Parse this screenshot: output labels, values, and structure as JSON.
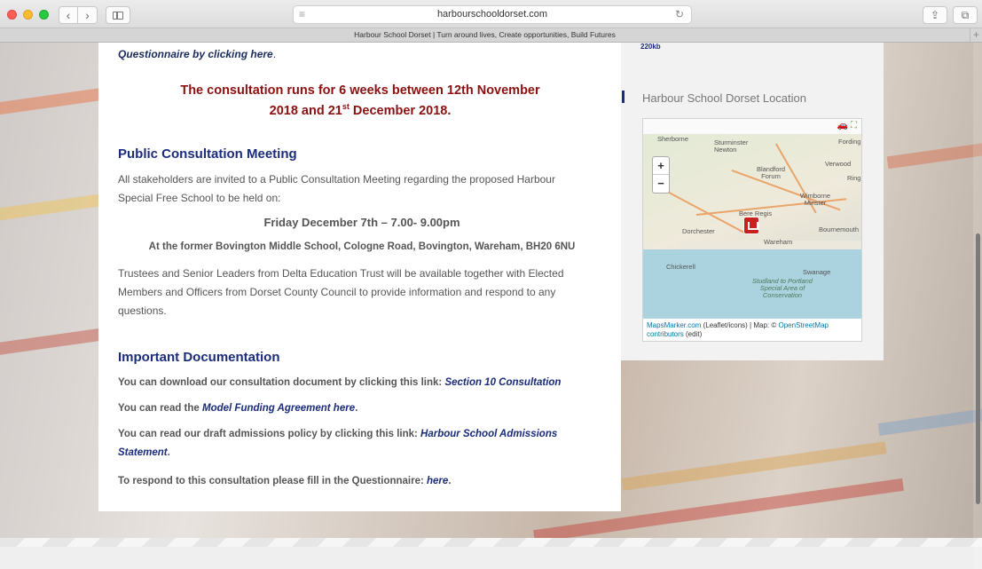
{
  "browser": {
    "url": "harbourschooldorset.com",
    "tab_title": "Harbour School Dorset | Turn around lives, Create opportunities, Build Futures",
    "back_glyph": "‹",
    "forward_glyph": "›",
    "reload_glyph": "↻",
    "reader_glyph": "≡",
    "share_glyph": "⇪",
    "tabs_glyph": "⧉",
    "new_tab_glyph": "+"
  },
  "main": {
    "questionnaire_top": "Questionnaire by clicking here",
    "consultation_banner_1": "The consultation runs for 6 weeks between 12th November",
    "consultation_banner_2_pre": "2018 and 21",
    "consultation_banner_2_sup": "st",
    "consultation_banner_2_post": " December 2018.",
    "meeting": {
      "heading": "Public Consultation Meeting",
      "intro": "All stakeholders are invited to a Public Consultation Meeting regarding the proposed Harbour Special Free School to be held on:",
      "date": "Friday December 7th – 7.00- 9.00pm",
      "venue": "At the former Bovington Middle School, Cologne Road, Bovington, Wareham, BH20 6NU",
      "details": "Trustees and Senior Leaders from Delta Education Trust will be available together with Elected Members and Officers from Dorset County Council to provide information and respond to any questions."
    },
    "docs": {
      "heading": "Important Documentation",
      "line1_text": "You can download our consultation document by clicking this link: ",
      "line1_link": "Section 10 Consultation",
      "line2_text": "You can read the ",
      "line2_link": "Model Funding Agreement here",
      "line3_text": "You can read our draft admissions policy by clicking this link: ",
      "line3_link": "Harbour School Admissions Statement",
      "line4_text": "To respond to this consultation please fill in the Questionnaire: ",
      "line4_link": "here"
    }
  },
  "sidebar": {
    "top_link": "220kb",
    "location_title": "Harbour School Dorset Location",
    "map": {
      "zoom_in": "+",
      "zoom_out": "−",
      "places": [
        "Sherborne",
        "Sturminster Newton",
        "Blandford Forum",
        "Verwood",
        "Fording",
        "Ring",
        "Wimborne Minster",
        "Bere Regis",
        "Dorchester",
        "Bournemouth",
        "Wareham",
        "Chickerell",
        "Swanage",
        "Studland to Portland Special Area of Conservation"
      ],
      "attribution_1": "MapsMarker.com",
      "attribution_2": " (Leaflet/icons) | Map: © ",
      "attribution_3": "OpenStreetMap",
      "attribution_4": "contributors",
      "attribution_5": " (edit)"
    }
  }
}
